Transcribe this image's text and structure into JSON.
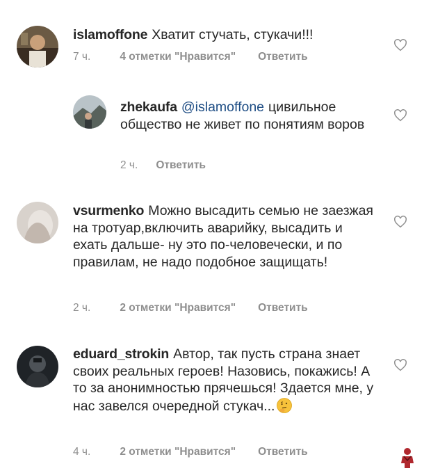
{
  "comments": [
    {
      "username": "islamoffone",
      "text": "Хватит стучать, стукачи!!!",
      "time": "7 ч.",
      "likes": "4 отметки \"Нравится\"",
      "reply": "Ответить"
    },
    {
      "username": "zhekaufa",
      "mention": "@islamoffone",
      "text": "цивильное общество не живет по понятиям воров",
      "time": "2 ч.",
      "reply": "Ответить"
    },
    {
      "username": "vsurmenko",
      "text": "Можно высадить семью не заезжая на тротуар,включить аварийку, высадить и ехать дальше- ну это по-человечески, и по правилам, не надо подобное защищать!",
      "time": "2 ч.",
      "likes": "2 отметки \"Нравится\"",
      "reply": "Ответить"
    },
    {
      "username": "eduard_strokin",
      "text": "Автор, так пусть страна знает своих реальных героев! Назовись, покажись! А то за анонимностью прячешься! Здается мне, у нас завелся очередной стукач...",
      "time": "4 ч.",
      "likes": "2 отметки \"Нравится\"",
      "reply": "Ответить"
    }
  ],
  "icons": {
    "like": "heart-outline-icon",
    "emoji": "thinking-face-emoji",
    "logo": "watermark-figure-icon"
  },
  "colors": {
    "text": "#262626",
    "meta": "#8e8e8e",
    "mention": "#1e4d84"
  }
}
